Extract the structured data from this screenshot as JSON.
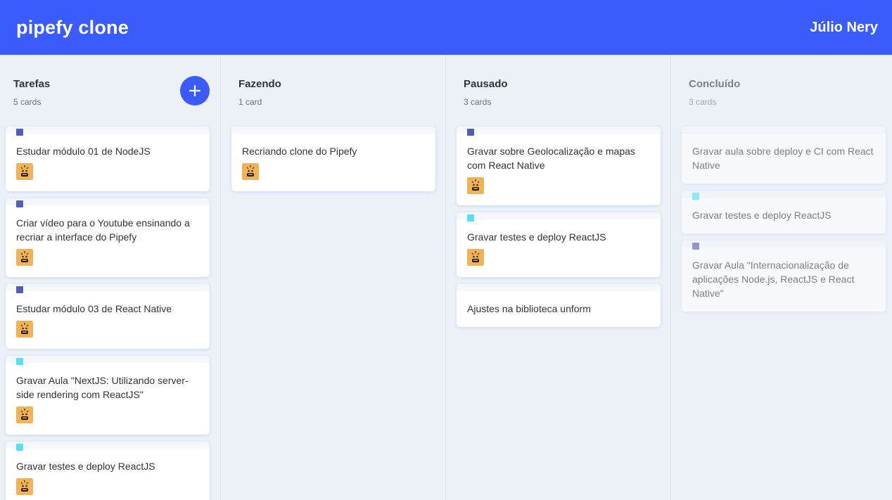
{
  "header": {
    "title": "pipefy clone",
    "user": "Júlio Nery"
  },
  "lists": [
    {
      "title": "Tarefas",
      "count": "5 cards",
      "cards": [
        {
          "label_color": "#5060b8",
          "text": "Estudar módulo 01 de NodeJS",
          "avatar": true
        },
        {
          "label_color": "#5060b8",
          "text": "Criar vídeo para o Youtube ensinando a recriar a interface do Pipefy",
          "avatar": true
        },
        {
          "label_color": "#5060b8",
          "text": "Estudar módulo 03 de React Native",
          "avatar": true
        },
        {
          "label_color": "#54e1f6",
          "text": "Gravar Aula \"NextJS: Utilizando server-side rendering com ReactJS\"",
          "avatar": true
        },
        {
          "label_color": "#54e1f6",
          "text": "Gravar testes e deploy ReactJS",
          "avatar": true
        }
      ]
    },
    {
      "title": "Fazendo",
      "count": "1 card",
      "cards": [
        {
          "label_color": "",
          "text": "Recriando clone do Pipefy",
          "avatar": true
        }
      ]
    },
    {
      "title": "Pausado",
      "count": "3 cards",
      "cards": [
        {
          "label_color": "#5060b8",
          "text": "Gravar sobre Geolocalização e mapas com React Native",
          "avatar": true
        },
        {
          "label_color": "#54e1f6",
          "text": "Gravar testes e deploy ReactJS",
          "avatar": true
        },
        {
          "label_color": "",
          "text": "Ajustes na biblioteca unform",
          "avatar": false
        }
      ]
    },
    {
      "title": "Concluído",
      "count": "3 cards",
      "cards": [
        {
          "label_color": "",
          "text": "Gravar aula sobre deploy e CI com React Native",
          "avatar": false
        },
        {
          "label_color": "#54e1f6",
          "text": "Gravar testes e deploy ReactJS",
          "avatar": false
        },
        {
          "label_color": "#5060b8",
          "text": "Gravar Aula \"Internacionalização de aplicações Node.js, ReactJS e React Native\"",
          "avatar": false
        }
      ]
    }
  ],
  "icons": {
    "add": "plus-icon",
    "avatar": "avatar-icon"
  },
  "colors": {
    "primary": "#3b5bfd",
    "background": "#ecf1f8",
    "label_dark": "#5060b8",
    "label_light": "#54e1f6"
  }
}
